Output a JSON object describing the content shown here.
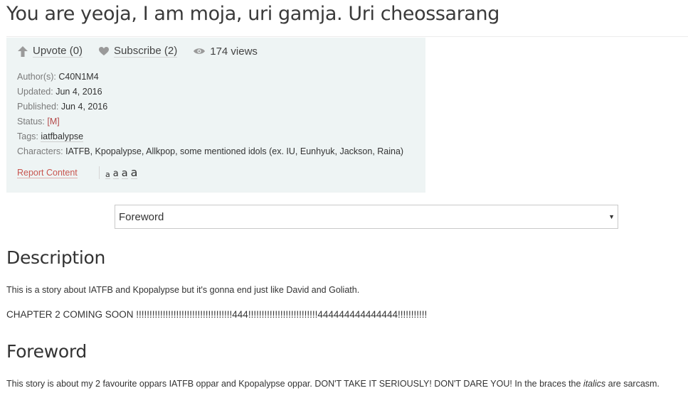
{
  "story": {
    "title": "You are yeoja, I am moja, uri gamja. Uri cheossarang"
  },
  "stats": {
    "upvote_label": "Upvote (0)",
    "subscribe_label": "Subscribe (2)",
    "views_label": "174 views",
    "icons": [
      "upvote-arrow-icon",
      "heart-icon",
      "eye-icon"
    ]
  },
  "meta": {
    "author_key": "Author(s):",
    "author": "C40N1M4",
    "updated_key": "Updated:",
    "updated": "Jun 4, 2016",
    "published_key": "Published:",
    "published": "Jun 4, 2016",
    "status_key": "Status:",
    "status": "[M]",
    "tags_key": "Tags:",
    "tag": "iatfbalypse",
    "characters_key": "Characters:",
    "characters": "IATFB, Kpopalypse, Allkpop, some mentioned idols (ex. IU, Eunhyuk, Jackson, Raina)"
  },
  "actions": {
    "report": "Report Content",
    "font_sizes": [
      "a",
      "a",
      "a",
      "a"
    ]
  },
  "chapter_select": {
    "selected": "Foreword"
  },
  "description": {
    "heading": "Description",
    "line1": "This is a story about IATFB and Kpopalypse but it's gonna end just like David and Goliath.",
    "line2": "CHAPTER 2 COMING SOON !!!!!!!!!!!!!!!!!!!!!!!!!!!!!!!!!!!!444!!!!!!!!!!!!!!!!!!!!!!!!!!444444444444444!!!!!!!!!!!"
  },
  "foreword": {
    "heading": "Foreword",
    "text_before": "This story is about my 2 favourite oppars IATFB oppar and Kpopalypse oppar. DON'T TAKE IT SERIOUSLY! DON'T DARE YOU! In the braces the ",
    "text_italic": "italics",
    "text_after": " are sarcasm."
  },
  "colors": {
    "panel_bg": "#eef4f4",
    "status": "#b44a4a",
    "report": "#c8554f"
  }
}
